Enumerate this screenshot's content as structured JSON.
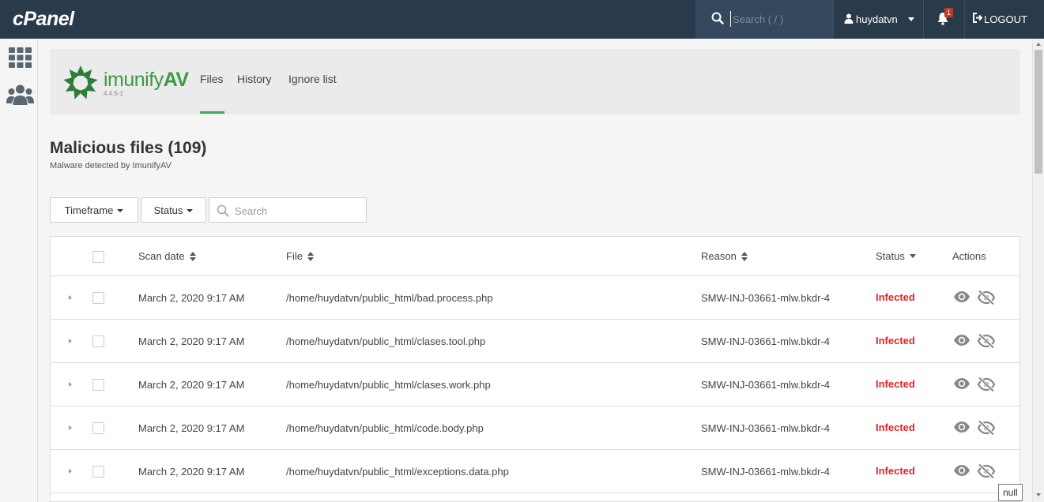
{
  "app": {
    "logo": "cPanel",
    "search_placeholder": "Search ( / )",
    "username": "huydatvn",
    "notification_count": "1",
    "logout_label": "LOGOUT"
  },
  "plugin": {
    "brand_prefix": "imunify",
    "brand_suffix": "AV",
    "version": "4.4.5-1",
    "tabs": [
      {
        "label": "Files",
        "active": true
      },
      {
        "label": "History",
        "active": false
      },
      {
        "label": "Ignore list",
        "active": false
      }
    ]
  },
  "page": {
    "title": "Malicious files (109)",
    "subtitle": "Malware detected by ImunifyAV"
  },
  "filters": {
    "timeframe_label": "Timeframe",
    "status_label": "Status",
    "search_placeholder": "Search"
  },
  "table": {
    "headers": {
      "scan_date": "Scan date",
      "file": "File",
      "reason": "Reason",
      "status": "Status",
      "actions": "Actions"
    },
    "rows": [
      {
        "scan_date": "March 2, 2020 9:17 AM",
        "file": "/home/huydatvn/public_html/bad.process.php",
        "reason": "SMW-INJ-03661-mlw.bkdr-4",
        "status": "Infected"
      },
      {
        "scan_date": "March 2, 2020 9:17 AM",
        "file": "/home/huydatvn/public_html/clases.tool.php",
        "reason": "SMW-INJ-03661-mlw.bkdr-4",
        "status": "Infected"
      },
      {
        "scan_date": "March 2, 2020 9:17 AM",
        "file": "/home/huydatvn/public_html/clases.work.php",
        "reason": "SMW-INJ-03661-mlw.bkdr-4",
        "status": "Infected"
      },
      {
        "scan_date": "March 2, 2020 9:17 AM",
        "file": "/home/huydatvn/public_html/code.body.php",
        "reason": "SMW-INJ-03661-mlw.bkdr-4",
        "status": "Infected"
      },
      {
        "scan_date": "March 2, 2020 9:17 AM",
        "file": "/home/huydatvn/public_html/exceptions.data.php",
        "reason": "SMW-INJ-03661-mlw.bkdr-4",
        "status": "Infected"
      }
    ]
  },
  "tooltip": "null",
  "colors": {
    "topbar": "#293a4a",
    "brand_green": "#3a9a42",
    "active_tab_underline": "#3aaa5c",
    "infected": "#e02424"
  },
  "icons": {
    "top_search": "search-icon",
    "user": "user-icon",
    "bell": "bell-icon",
    "logout": "logout-icon",
    "sidebar_grid": "grid-icon",
    "sidebar_users": "users-icon",
    "row_view": "eye-icon",
    "row_ignore": "eye-slash-icon"
  }
}
